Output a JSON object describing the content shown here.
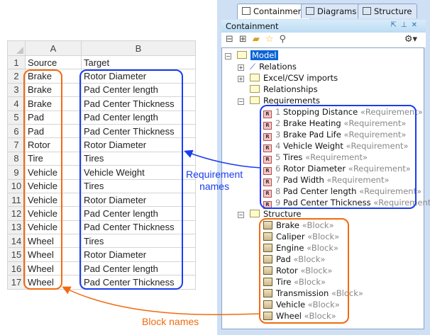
{
  "spreadsheet": {
    "columns": [
      "A",
      "B"
    ],
    "rows": [
      [
        "Source",
        "Target"
      ],
      [
        "Brake",
        "Rotor Diameter"
      ],
      [
        "Brake",
        "Pad Center length"
      ],
      [
        "Brake",
        "Pad Center Thickness"
      ],
      [
        "Pad",
        "Pad Center length"
      ],
      [
        "Pad",
        "Pad Center Thickness"
      ],
      [
        "Rotor",
        "Rotor Diameter"
      ],
      [
        "Tire",
        "Tires"
      ],
      [
        "Vehicle",
        "Vehicle Weight"
      ],
      [
        "Vehicle",
        "Tires"
      ],
      [
        "Vehicle",
        "Rotor Diameter"
      ],
      [
        "Vehicle",
        "Pad Center length"
      ],
      [
        "Vehicle",
        "Pad Center Thickness"
      ],
      [
        "Wheel",
        "Tires"
      ],
      [
        "Wheel",
        "Rotor Diameter"
      ],
      [
        "Wheel",
        "Pad Center length"
      ],
      [
        "Wheel",
        "Pad Center Thickness"
      ]
    ]
  },
  "tabs": [
    "Containment",
    "Diagrams",
    "Structure"
  ],
  "panel_title": "Containment",
  "tree": {
    "root": "Model",
    "folders": [
      "Relations",
      "Excel/CSV imports",
      "Relationships",
      "Requirements",
      "Structure"
    ],
    "requirements": [
      {
        "n": "1",
        "name": "Stopping Distance"
      },
      {
        "n": "2",
        "name": "Brake Heating"
      },
      {
        "n": "3",
        "name": "Brake Pad Life"
      },
      {
        "n": "4",
        "name": "Vehicle Weight"
      },
      {
        "n": "5",
        "name": "Tires"
      },
      {
        "n": "6",
        "name": "Rotor Diameter"
      },
      {
        "n": "7",
        "name": "Pad Width"
      },
      {
        "n": "8",
        "name": "Pad Center length"
      },
      {
        "n": "9",
        "name": "Pad Center Thickness"
      }
    ],
    "req_stereo": "«Requirement»",
    "blocks": [
      "Brake",
      "Caliper",
      "Engine",
      "Pad",
      "Rotor",
      "Tire",
      "Transmission",
      "Vehicle",
      "Wheel"
    ],
    "block_stereo": "«Block»"
  },
  "annotations": {
    "req_line1": "Requirement",
    "req_line2": "names",
    "block": "Block names"
  },
  "colors": {
    "blue": "#1a3cf0",
    "orange": "#f26a0f"
  }
}
